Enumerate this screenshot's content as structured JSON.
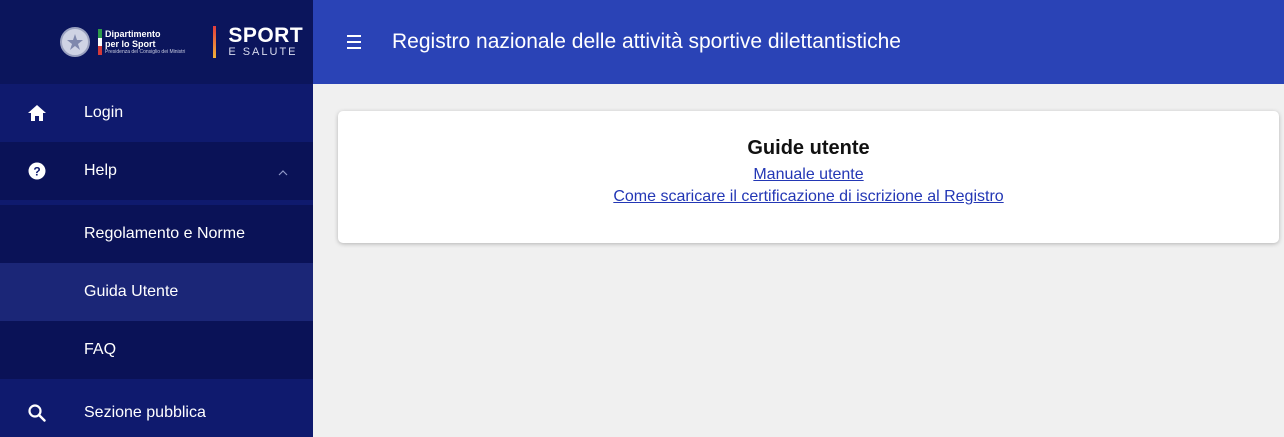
{
  "brand": {
    "dipartimento_line1": "Dipartimento",
    "dipartimento_line2": "per lo Sport",
    "dipartimento_line3": "Presidenza del Consiglio dei Ministri",
    "sport_big": "SPORT",
    "sport_small": "E SALUTE"
  },
  "header": {
    "title": "Registro nazionale delle attività sportive dilettantistiche"
  },
  "sidebar": {
    "items": [
      {
        "label": "Login",
        "icon": "home-icon"
      },
      {
        "label": "Help",
        "icon": "help-circle-icon",
        "expanded": true
      },
      {
        "label": "Regolamento e Norme"
      },
      {
        "label": "Guida Utente",
        "active": true
      },
      {
        "label": "FAQ"
      },
      {
        "label": "Sezione pubblica",
        "icon": "search-icon"
      }
    ]
  },
  "main": {
    "card_title": "Guide utente",
    "links": [
      "Manuale utente",
      "Come scaricare il certificazione di iscrizione al Registro"
    ]
  },
  "colors": {
    "sidebar": "#0f1a6e",
    "topbar": "#2a43b6",
    "link": "#2337b5"
  }
}
